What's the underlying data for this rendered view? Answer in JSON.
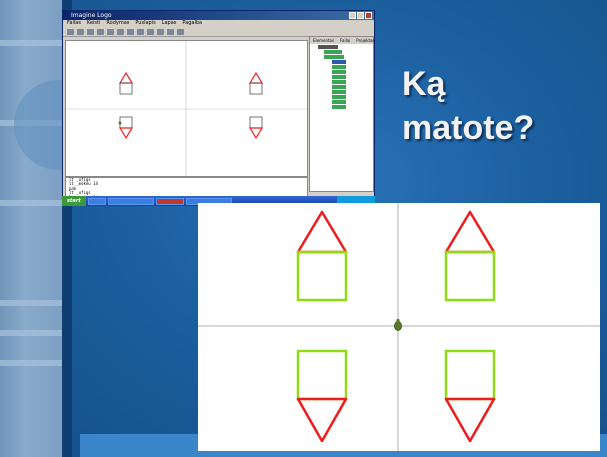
{
  "slide": {
    "title_line1": "Ką",
    "title_line2": "matote?"
  },
  "window": {
    "title": "Imagine Logo",
    "menu": [
      "Failas",
      "Keisti",
      "Rodymas",
      "Puslapis",
      "Lapas",
      "Pagalba"
    ],
    "side_tabs": [
      "Elementas",
      "Failai",
      "Projektas"
    ],
    "console_lines": [
      "lt _ufigs",
      "lt _mokeu 14",
      "pak",
      "lt _ufigs",
      "lt _mokeu 14"
    ],
    "start_label": "start"
  },
  "colors": {
    "triangle": "#ee1c1c",
    "square": "#8fdc14",
    "axis": "#b0b0b0",
    "turtle": "#5a7a2a"
  }
}
